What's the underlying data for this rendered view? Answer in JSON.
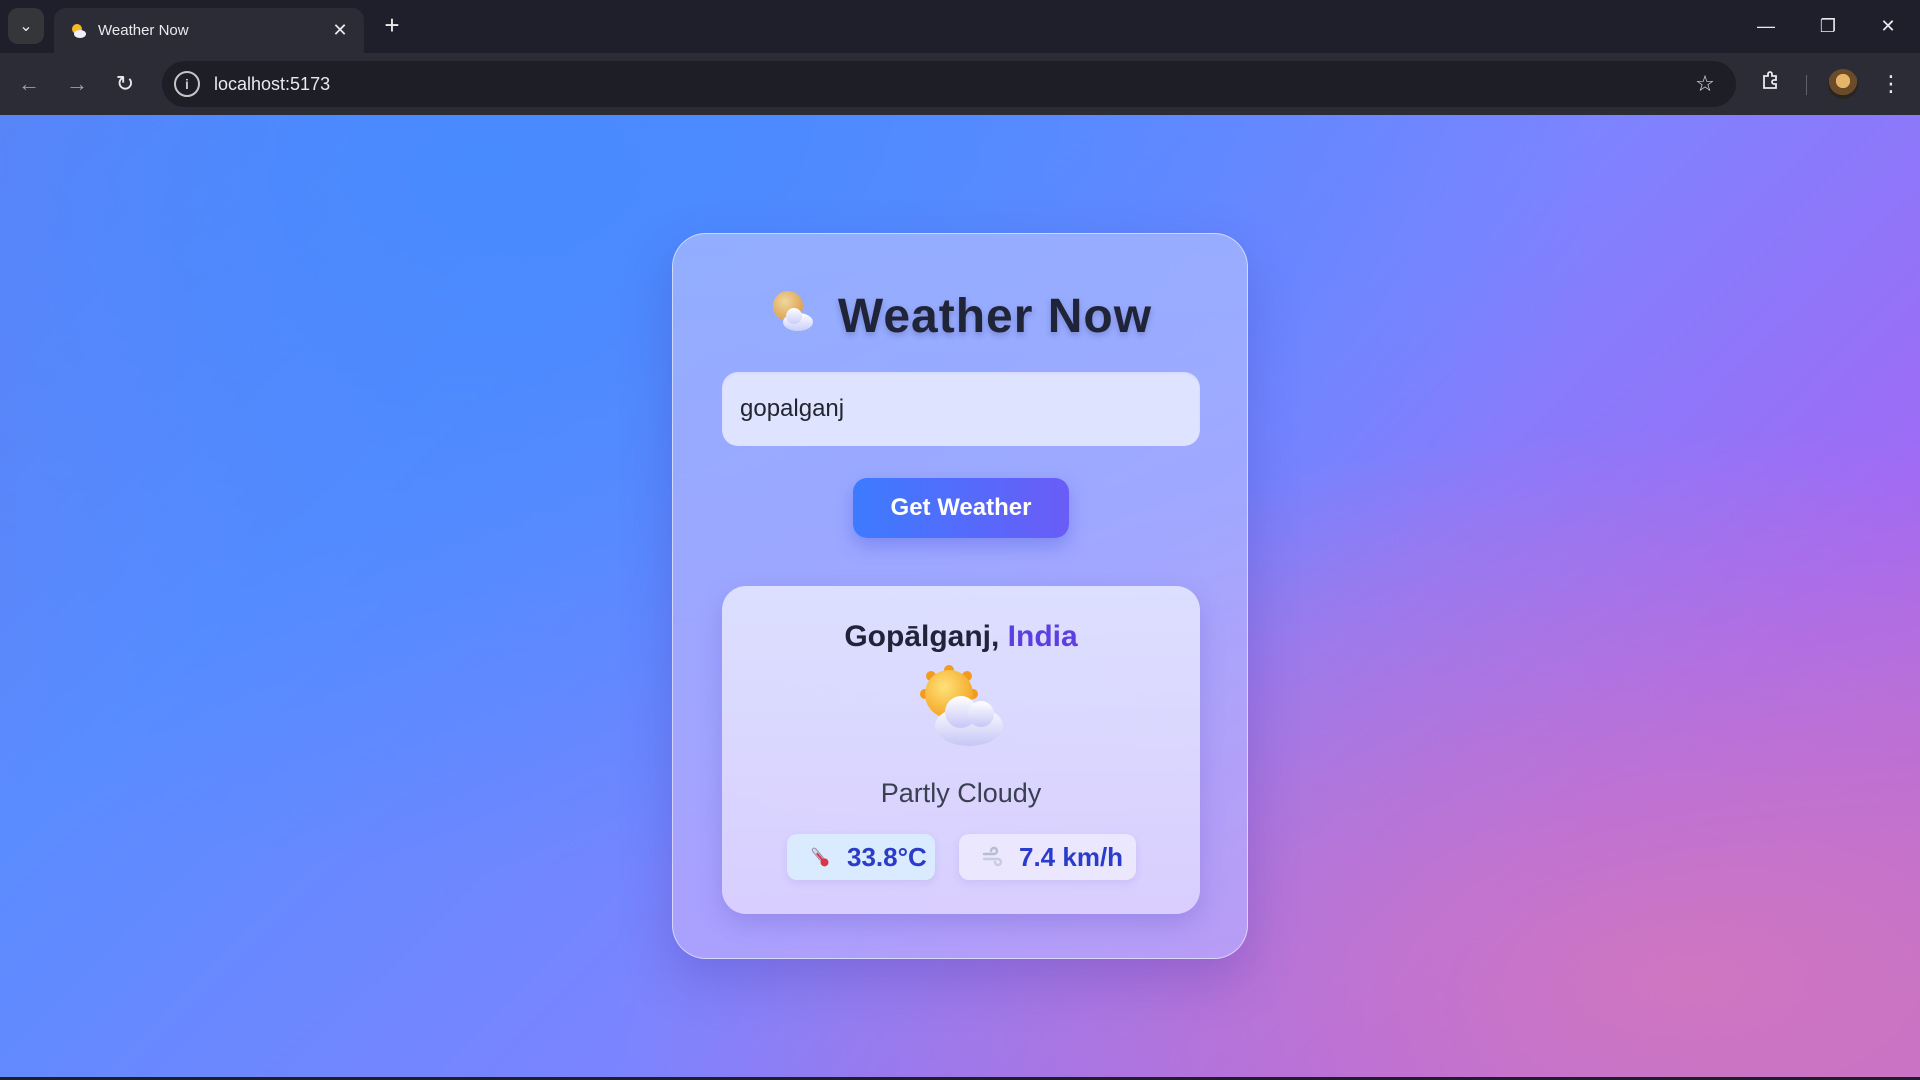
{
  "browser": {
    "tab_title": "Weather Now",
    "url": "localhost:5173",
    "icons": {
      "tab_search": "chevron-down-icon",
      "favicon": "sun-cloud-icon",
      "tab_close": "close-icon",
      "new_tab": "plus-icon",
      "back": "back-arrow-icon",
      "forward": "forward-arrow-icon",
      "reload": "reload-icon",
      "site_info": "info-icon",
      "bookmark": "star-icon",
      "extensions": "puzzle-icon",
      "menu": "kebab-menu-icon"
    }
  },
  "app": {
    "title": "Weather Now",
    "search": {
      "value": "gopalganj",
      "placeholder": ""
    },
    "button_label": "Get Weather",
    "result": {
      "city": "Gopālganj,",
      "country": "India",
      "condition": "Partly Cloudy",
      "temperature": "33.8°C",
      "wind": "7.4 km/h",
      "weather_icon": "partly-cloudy-icon",
      "temp_icon": "thermometer-icon",
      "wind_icon": "wind-icon"
    },
    "colors": {
      "accent": "#3d7bff",
      "country_text": "#5b3fe0",
      "value_text": "#2a3cc9"
    }
  }
}
